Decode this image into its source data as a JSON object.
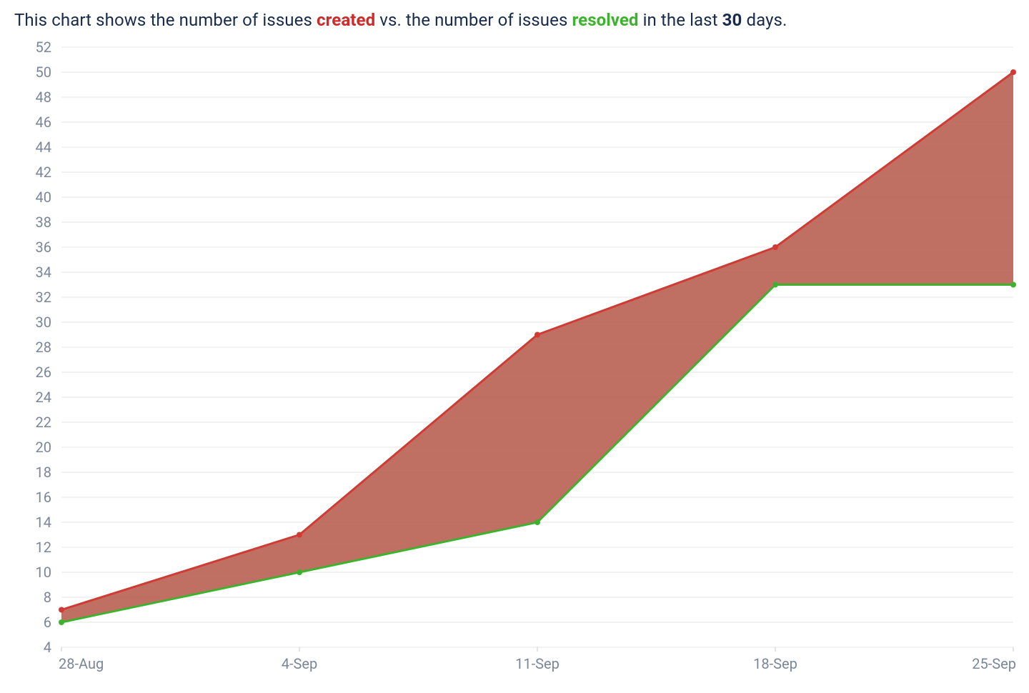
{
  "caption": {
    "p1": "This chart shows the number of issues ",
    "created": "created",
    "p2": " vs. the number of issues ",
    "resolved": "resolved",
    "p3": " in the last ",
    "days": "30",
    "p4": " days."
  },
  "colors": {
    "created": "#d13b34",
    "resolved": "#3db22e",
    "fill": "#b86052",
    "grid": "#e6e6e6",
    "axis_text": "#7a8699"
  },
  "chart_data": {
    "type": "line",
    "title": "",
    "xlabel": "",
    "ylabel": "",
    "ylim": [
      4,
      52
    ],
    "y_ticks": [
      4,
      6,
      8,
      10,
      12,
      14,
      16,
      18,
      20,
      22,
      24,
      26,
      28,
      30,
      32,
      34,
      36,
      38,
      40,
      42,
      44,
      46,
      48,
      50,
      52
    ],
    "categories": [
      "28-Aug",
      "4-Sep",
      "11-Sep",
      "18-Sep",
      "25-Sep"
    ],
    "series": [
      {
        "name": "created",
        "color": "#d13b34",
        "values": [
          7,
          13,
          29,
          36,
          50
        ]
      },
      {
        "name": "resolved",
        "color": "#3db22e",
        "values": [
          6,
          10,
          14,
          33,
          33
        ]
      }
    ],
    "fill_between": {
      "upper": "created",
      "lower": "resolved",
      "color": "#b86052"
    },
    "grid": true,
    "legend": false
  }
}
